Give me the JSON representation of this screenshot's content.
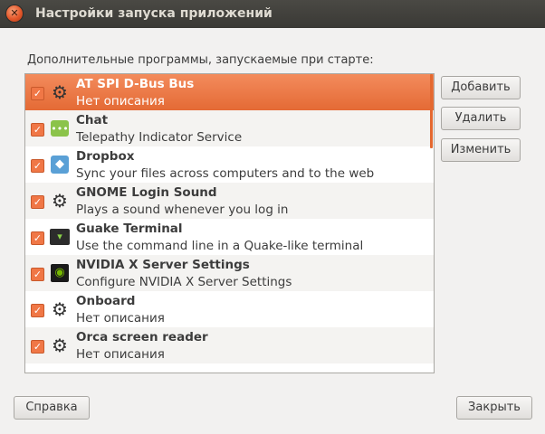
{
  "window": {
    "title": "Настройки запуска приложений"
  },
  "description": "Дополнительные программы, запускаемые при старте:",
  "items": [
    {
      "name": "AT SPI D-Bus Bus",
      "comment": "Нет описания",
      "checked": true,
      "selected": true,
      "icon": "gear-icon"
    },
    {
      "name": "Chat",
      "comment": "Telepathy Indicator Service",
      "checked": true,
      "icon": "chat-icon"
    },
    {
      "name": "Dropbox",
      "comment": "Sync your files across computers and to the web",
      "checked": true,
      "icon": "dropbox-icon"
    },
    {
      "name": "GNOME Login Sound",
      "comment": "Plays a sound whenever you log in",
      "checked": true,
      "icon": "gear-icon"
    },
    {
      "name": "Guake Terminal",
      "comment": "Use the command line in a Quake-like terminal",
      "checked": true,
      "icon": "terminal-icon"
    },
    {
      "name": "NVIDIA X Server Settings",
      "comment": "Configure NVIDIA X Server Settings",
      "checked": true,
      "icon": "nvidia-icon"
    },
    {
      "name": "Onboard",
      "comment": "Нет описания",
      "checked": true,
      "icon": "gear-icon"
    },
    {
      "name": "Orca screen reader",
      "comment": "Нет описания",
      "checked": true,
      "icon": "gear-icon"
    }
  ],
  "buttons": {
    "add": "Добавить",
    "remove": "Удалить",
    "edit": "Изменить",
    "help": "Справка",
    "close": "Закрыть"
  },
  "colors": {
    "accent": "#e4682f",
    "titlebar": "#3c3b37"
  }
}
